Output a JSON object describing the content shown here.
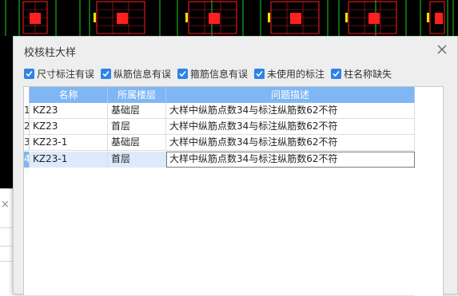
{
  "dialog": {
    "title": "校核柱大样",
    "close_icon": "close-icon"
  },
  "filters": [
    {
      "label": "尺寸标注有误",
      "checked": true
    },
    {
      "label": "纵筋信息有误",
      "checked": true
    },
    {
      "label": "箍筋信息有误",
      "checked": true
    },
    {
      "label": "未使用的标注",
      "checked": true
    },
    {
      "label": "柱名称缺失",
      "checked": true
    }
  ],
  "table": {
    "headers": [
      "名称",
      "所属楼层",
      "问题描述"
    ],
    "rows": [
      {
        "num": "1",
        "name": "KZ23",
        "floor": "基础层",
        "desc": "大样中纵筋点数34与标注纵筋数62不符"
      },
      {
        "num": "2",
        "name": "KZ23",
        "floor": "首层",
        "desc": "大样中纵筋点数34与标注纵筋数62不符"
      },
      {
        "num": "3",
        "name": "KZ23-1",
        "floor": "基础层",
        "desc": "大样中纵筋点数34与标注纵筋数62不符"
      },
      {
        "num": "4",
        "name": "KZ23-1",
        "floor": "首层",
        "desc": "大样中纵筋点数34与标注纵筋数62不符"
      }
    ],
    "selected_row": 4
  },
  "colors": {
    "accent": "#2f82e6",
    "header_bg": "#7fb6f4",
    "cad_bg": "#000000",
    "cad_red": "#ff2020",
    "cad_green": "#19d419",
    "cad_yellow": "#e8e800"
  }
}
